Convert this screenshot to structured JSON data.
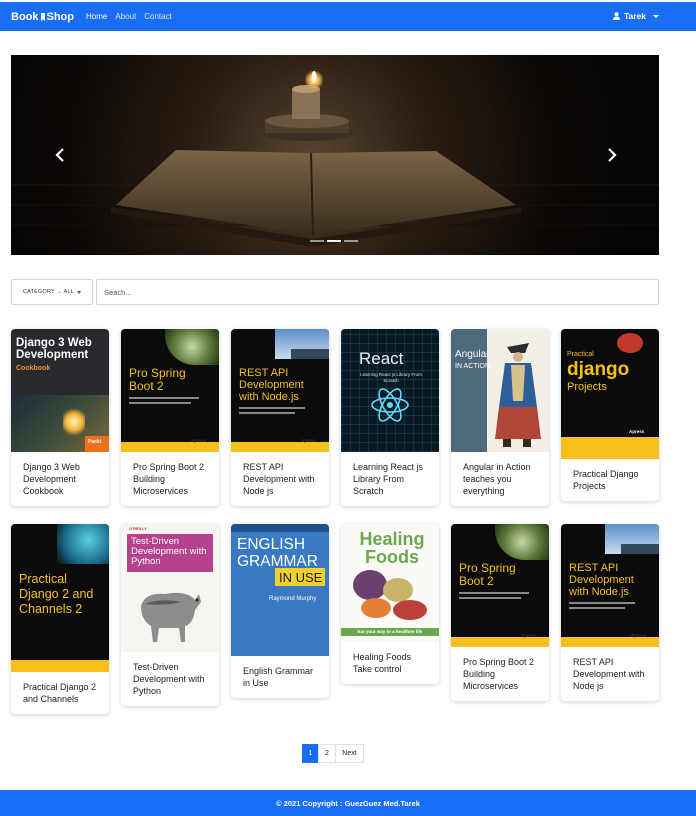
{
  "navbar": {
    "brand_left": "Book",
    "brand_right": "Shop",
    "links": [
      "Home",
      "About",
      "Contact"
    ],
    "user": "Tarek"
  },
  "filters": {
    "category_label": "CATEGORY → ALL",
    "search_placeholder": "Seach..."
  },
  "books": [
    {
      "title": "Django 3 Web Development Cookbook",
      "cover_text": "Django 3 Web Development",
      "cover_sub": "Cookbook",
      "publisher": "Packt"
    },
    {
      "title": "Pro Spring Boot 2 Building Microservices",
      "cover_text": "Pro Spring Boot 2",
      "publisher": "Apress"
    },
    {
      "title": "REST API Development with Node js",
      "cover_text": "REST API Development with Node.js",
      "publisher": "Apress"
    },
    {
      "title": "Learning React js Library From Scratch",
      "cover_text": "React",
      "cover_sub": "Learning React js Library From Scratch"
    },
    {
      "title": "Angular in Action teaches you everything",
      "cover_text": "Angular",
      "cover_sub": "IN ACTION"
    },
    {
      "title": "Practical Django Projects",
      "cover_text": "django",
      "cover_pre": "Practical",
      "cover_sub": "Projects",
      "publisher": "Apress"
    },
    {
      "title": "Practical Django 2 and Channels",
      "cover_text": "Practical Django 2 and Channels 2",
      "publisher": "Apress"
    },
    {
      "title": "Test-Driven Development with Python",
      "cover_text": "Test-Driven Development with Python",
      "cover_pre": "O'REILLY"
    },
    {
      "title": "English Grammar in Use",
      "cover_text": "ENGLISH GRAMMAR",
      "cover_sub": "IN USE",
      "cover_author": "Raymond Murphy"
    },
    {
      "title": "Healing Foods Take control",
      "cover_text": "Healing Foods",
      "cover_sub": "Eat your way to a healthier life"
    },
    {
      "title": "Pro Spring Boot 2 Building Microservices",
      "cover_text": "Pro Spring Boot 2",
      "publisher": "Apress"
    },
    {
      "title": "REST API Development with Node js",
      "cover_text": "REST API Development with Node.js",
      "publisher": "Apress"
    }
  ],
  "pagination": {
    "pages": [
      "1",
      "2"
    ],
    "next": "Next"
  },
  "footer": {
    "text": "© 2021 Copyright : GuezGuez Med.Tarek"
  },
  "colors": {
    "primary": "#1a6ef5",
    "apress_yellow": "#f6c01a"
  }
}
